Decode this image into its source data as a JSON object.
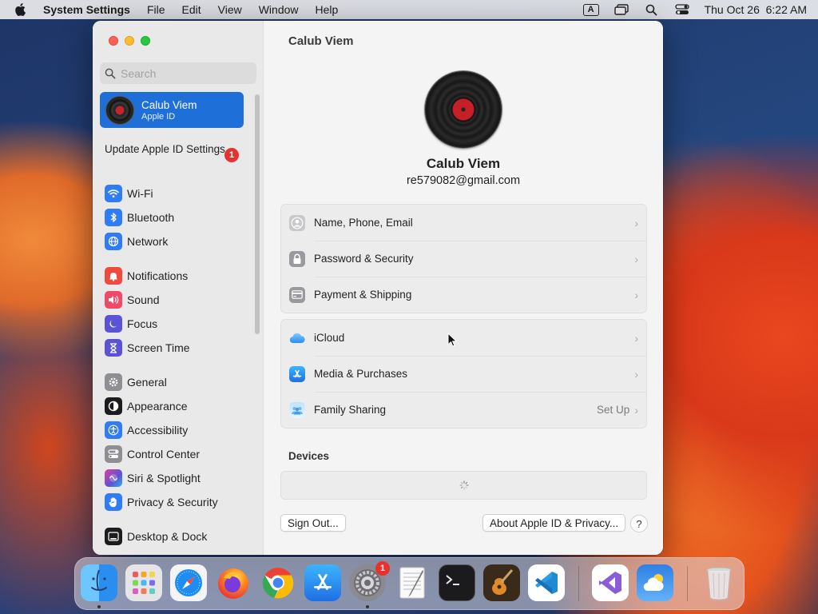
{
  "menubar": {
    "app_name": "System Settings",
    "menus": [
      "File",
      "Edit",
      "View",
      "Window",
      "Help"
    ],
    "input_source": "A",
    "clock": "Thu Oct 26  6:22 AM"
  },
  "window": {
    "title": "Calub Viem"
  },
  "sidebar": {
    "search_placeholder": "Search",
    "account": {
      "name": "Calub Viem",
      "subtitle": "Apple ID"
    },
    "update": {
      "label": "Update Apple ID Settings",
      "badge": "1"
    },
    "items": [
      {
        "label": "Wi-Fi",
        "icon": "wifi-icon",
        "color": "#2f7cf6"
      },
      {
        "label": "Bluetooth",
        "icon": "bluetooth-icon",
        "color": "#2f7cf6"
      },
      {
        "label": "Network",
        "icon": "globe-icon",
        "color": "#2f7cf6"
      },
      {
        "label": "Notifications",
        "icon": "bell-icon",
        "color": "#ef4a3e"
      },
      {
        "label": "Sound",
        "icon": "speaker-icon",
        "color": "#ef4a6a"
      },
      {
        "label": "Focus",
        "icon": "moon-icon",
        "color": "#5b53d6"
      },
      {
        "label": "Screen Time",
        "icon": "hourglass-icon",
        "color": "#5b53d6"
      },
      {
        "label": "General",
        "icon": "gear-icon",
        "color": "#8e8e93"
      },
      {
        "label": "Appearance",
        "icon": "appearance-icon",
        "color": "#1c1c1e"
      },
      {
        "label": "Accessibility",
        "icon": "accessibility-icon",
        "color": "#2f7cf6"
      },
      {
        "label": "Control Center",
        "icon": "control-center-icon",
        "color": "#8e8e93"
      },
      {
        "label": "Siri & Spotlight",
        "icon": "siri-icon",
        "color": "#b14ad8"
      },
      {
        "label": "Privacy & Security",
        "icon": "hand-icon",
        "color": "#2f7cf6"
      },
      {
        "label": "Desktop & Dock",
        "icon": "desktop-icon",
        "color": "#1c1c1e"
      }
    ]
  },
  "profile": {
    "name": "Calub Viem",
    "email": "re579082@gmail.com"
  },
  "groups": {
    "account_rows": [
      {
        "label": "Name, Phone, Email",
        "icon": "person-icon"
      },
      {
        "label": "Password & Security",
        "icon": "lock-icon"
      },
      {
        "label": "Payment & Shipping",
        "icon": "card-icon"
      }
    ],
    "services_rows": [
      {
        "label": "iCloud",
        "icon": "cloud-icon"
      },
      {
        "label": "Media & Purchases",
        "icon": "app-store-icon"
      },
      {
        "label": "Family Sharing",
        "icon": "family-icon",
        "value": "Set Up"
      }
    ]
  },
  "devices": {
    "title": "Devices"
  },
  "buttons": {
    "sign_out": "Sign Out...",
    "about": "About Apple ID & Privacy...",
    "help": "?"
  },
  "dock": {
    "settings_badge": "1",
    "apps": [
      "finder",
      "launchpad",
      "safari",
      "firefox",
      "chrome",
      "app-store",
      "system-settings",
      "textedit",
      "terminal",
      "garageband",
      "vscode",
      "visual-studio",
      "weather",
      "trash"
    ]
  }
}
